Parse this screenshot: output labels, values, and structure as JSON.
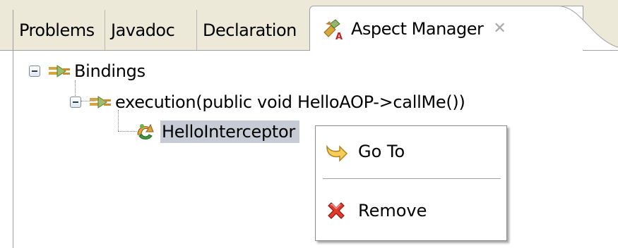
{
  "tabs": [
    {
      "label": "Problems",
      "active": false
    },
    {
      "label": "Javadoc",
      "active": false
    },
    {
      "label": "Declaration",
      "active": false
    },
    {
      "label": "Aspect Manager",
      "active": true,
      "icon": "aspect-manager-icon",
      "closable": true
    }
  ],
  "tree": {
    "root": {
      "label": "Bindings",
      "expanded": true,
      "icon": "binding-icon"
    },
    "child": {
      "label": "execution(public void HelloAOP->callMe())",
      "expanded": true,
      "icon": "binding-icon"
    },
    "leaf": {
      "label": "HelloInterceptor",
      "selected": true,
      "icon": "interceptor-icon"
    }
  },
  "context_menu": {
    "items": [
      {
        "label": "Go To",
        "icon": "goto-arrow-icon"
      },
      {
        "label": "Remove",
        "icon": "remove-x-icon"
      }
    ]
  },
  "colors": {
    "tab_background": "#ece9d8",
    "selection": "#c6cbd6",
    "remove_red": "#d62020",
    "goto_yellow": "#f0c040"
  }
}
